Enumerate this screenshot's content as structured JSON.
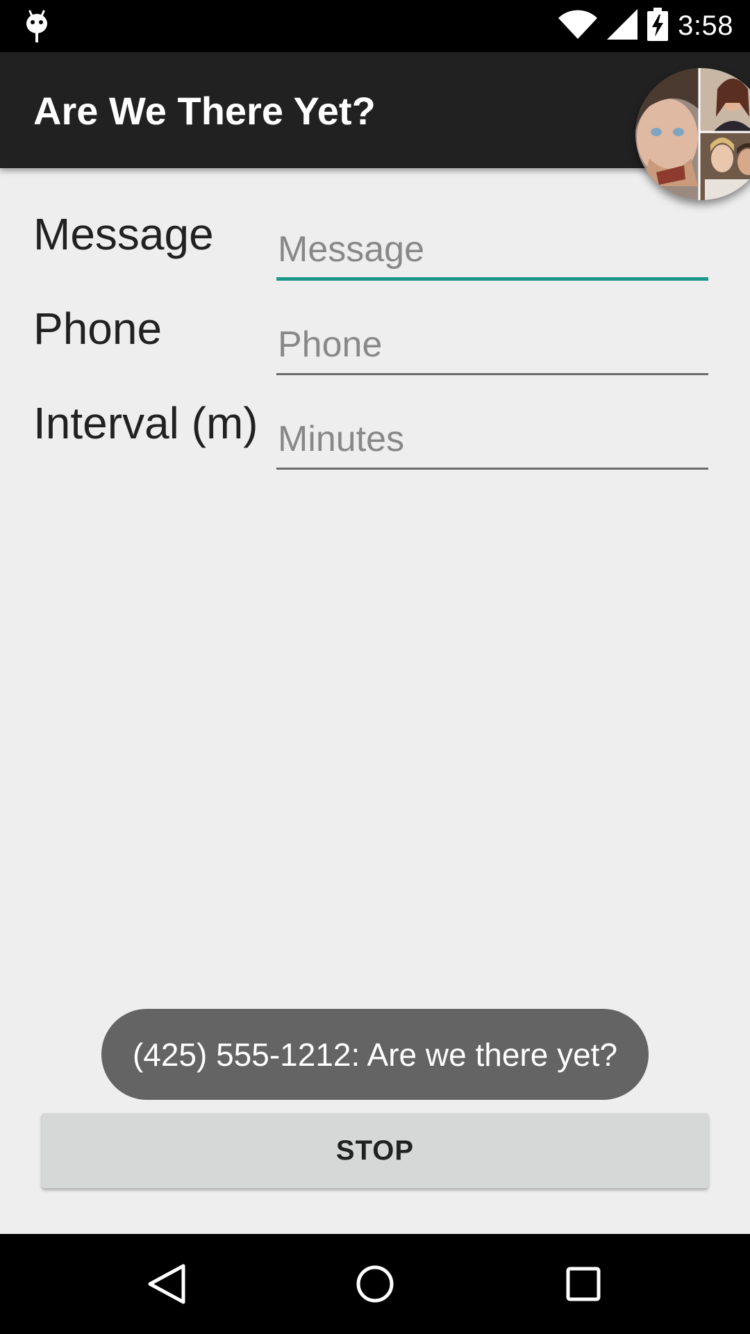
{
  "status_bar": {
    "time": "3:58",
    "icons": [
      "android-debug-icon",
      "wifi-icon",
      "cell-signal-icon",
      "battery-charging-icon"
    ]
  },
  "app_bar": {
    "title": "Are We There Yet?"
  },
  "chat_head": {
    "icon": "contact-photo-collage"
  },
  "form": {
    "message": {
      "label": "Message",
      "placeholder": "Message",
      "value": ""
    },
    "phone": {
      "label": "Phone",
      "placeholder": "Phone",
      "value": ""
    },
    "interval": {
      "label": "Interval (m)",
      "placeholder": "Minutes",
      "value": ""
    }
  },
  "toast": {
    "text": "(425) 555-1212: Are we there yet?"
  },
  "actions": {
    "stop_label": "STOP"
  },
  "nav_bar": {
    "icons": [
      "back-icon",
      "home-icon",
      "recents-icon"
    ]
  },
  "colors": {
    "accent": "#1a9688",
    "app_bar": "#212121",
    "background": "#eeeeee",
    "toast": "#646464",
    "button": "#d6d7d7"
  }
}
